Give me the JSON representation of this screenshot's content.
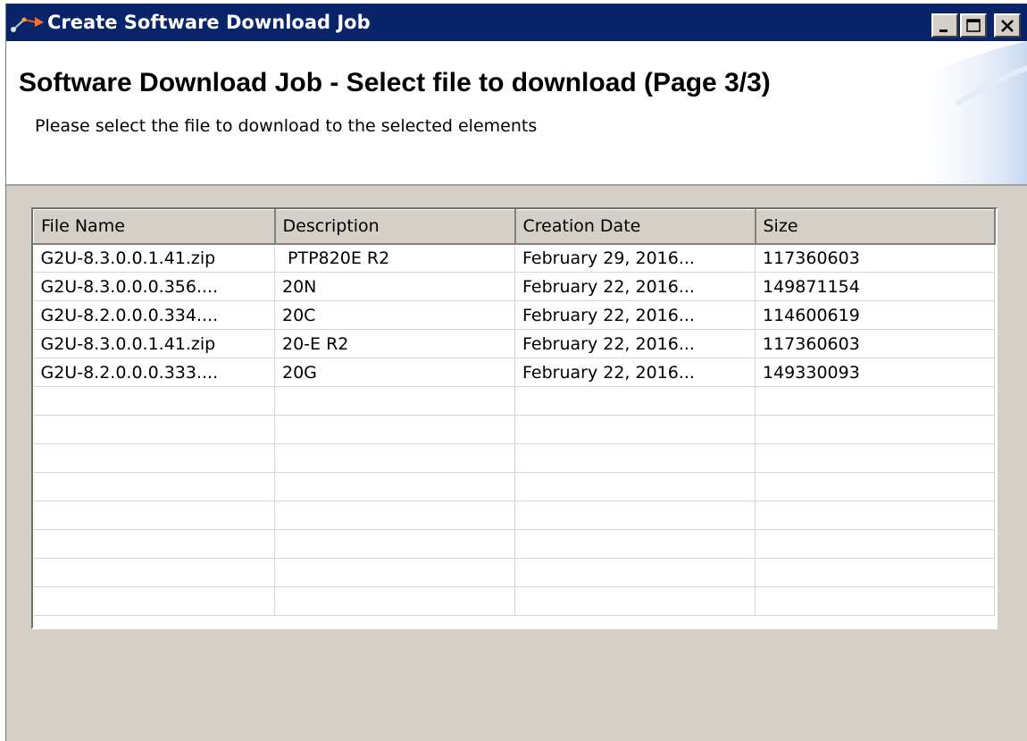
{
  "window": {
    "title": "Create Software Download Job",
    "icon": "app-wizard-icon",
    "controls": [
      "minimize-icon",
      "maximize-icon",
      "close-icon"
    ]
  },
  "header": {
    "title": "Software Download Job - Select file to download (Page 3/3)",
    "subtitle": "Please select the file to download to the selected elements"
  },
  "table": {
    "columns": [
      "File Name",
      "Description",
      "Creation Date",
      "Size"
    ],
    "rows": [
      [
        "G2U-8.3.0.0.1.41.zip",
        " PTP820E R2",
        "February 29, 2016...",
        "117360603"
      ],
      [
        "G2U-8.3.0.0.0.356....",
        "20N",
        "February 22, 2016...",
        "149871154"
      ],
      [
        "G2U-8.2.0.0.0.334....",
        "20C",
        "February 22, 2016...",
        "114600619"
      ],
      [
        "G2U-8.3.0.0.1.41.zip",
        "20-E R2",
        "February 22, 2016...",
        "117360603"
      ],
      [
        "G2U-8.2.0.0.0.333....",
        "20G",
        "February 22, 2016...",
        "149330093"
      ]
    ],
    "empty_rows": 8
  },
  "colors": {
    "titlebar": "#0a246a",
    "dialog_bg": "#d4d0c8",
    "header_bg": "#ffffff"
  }
}
